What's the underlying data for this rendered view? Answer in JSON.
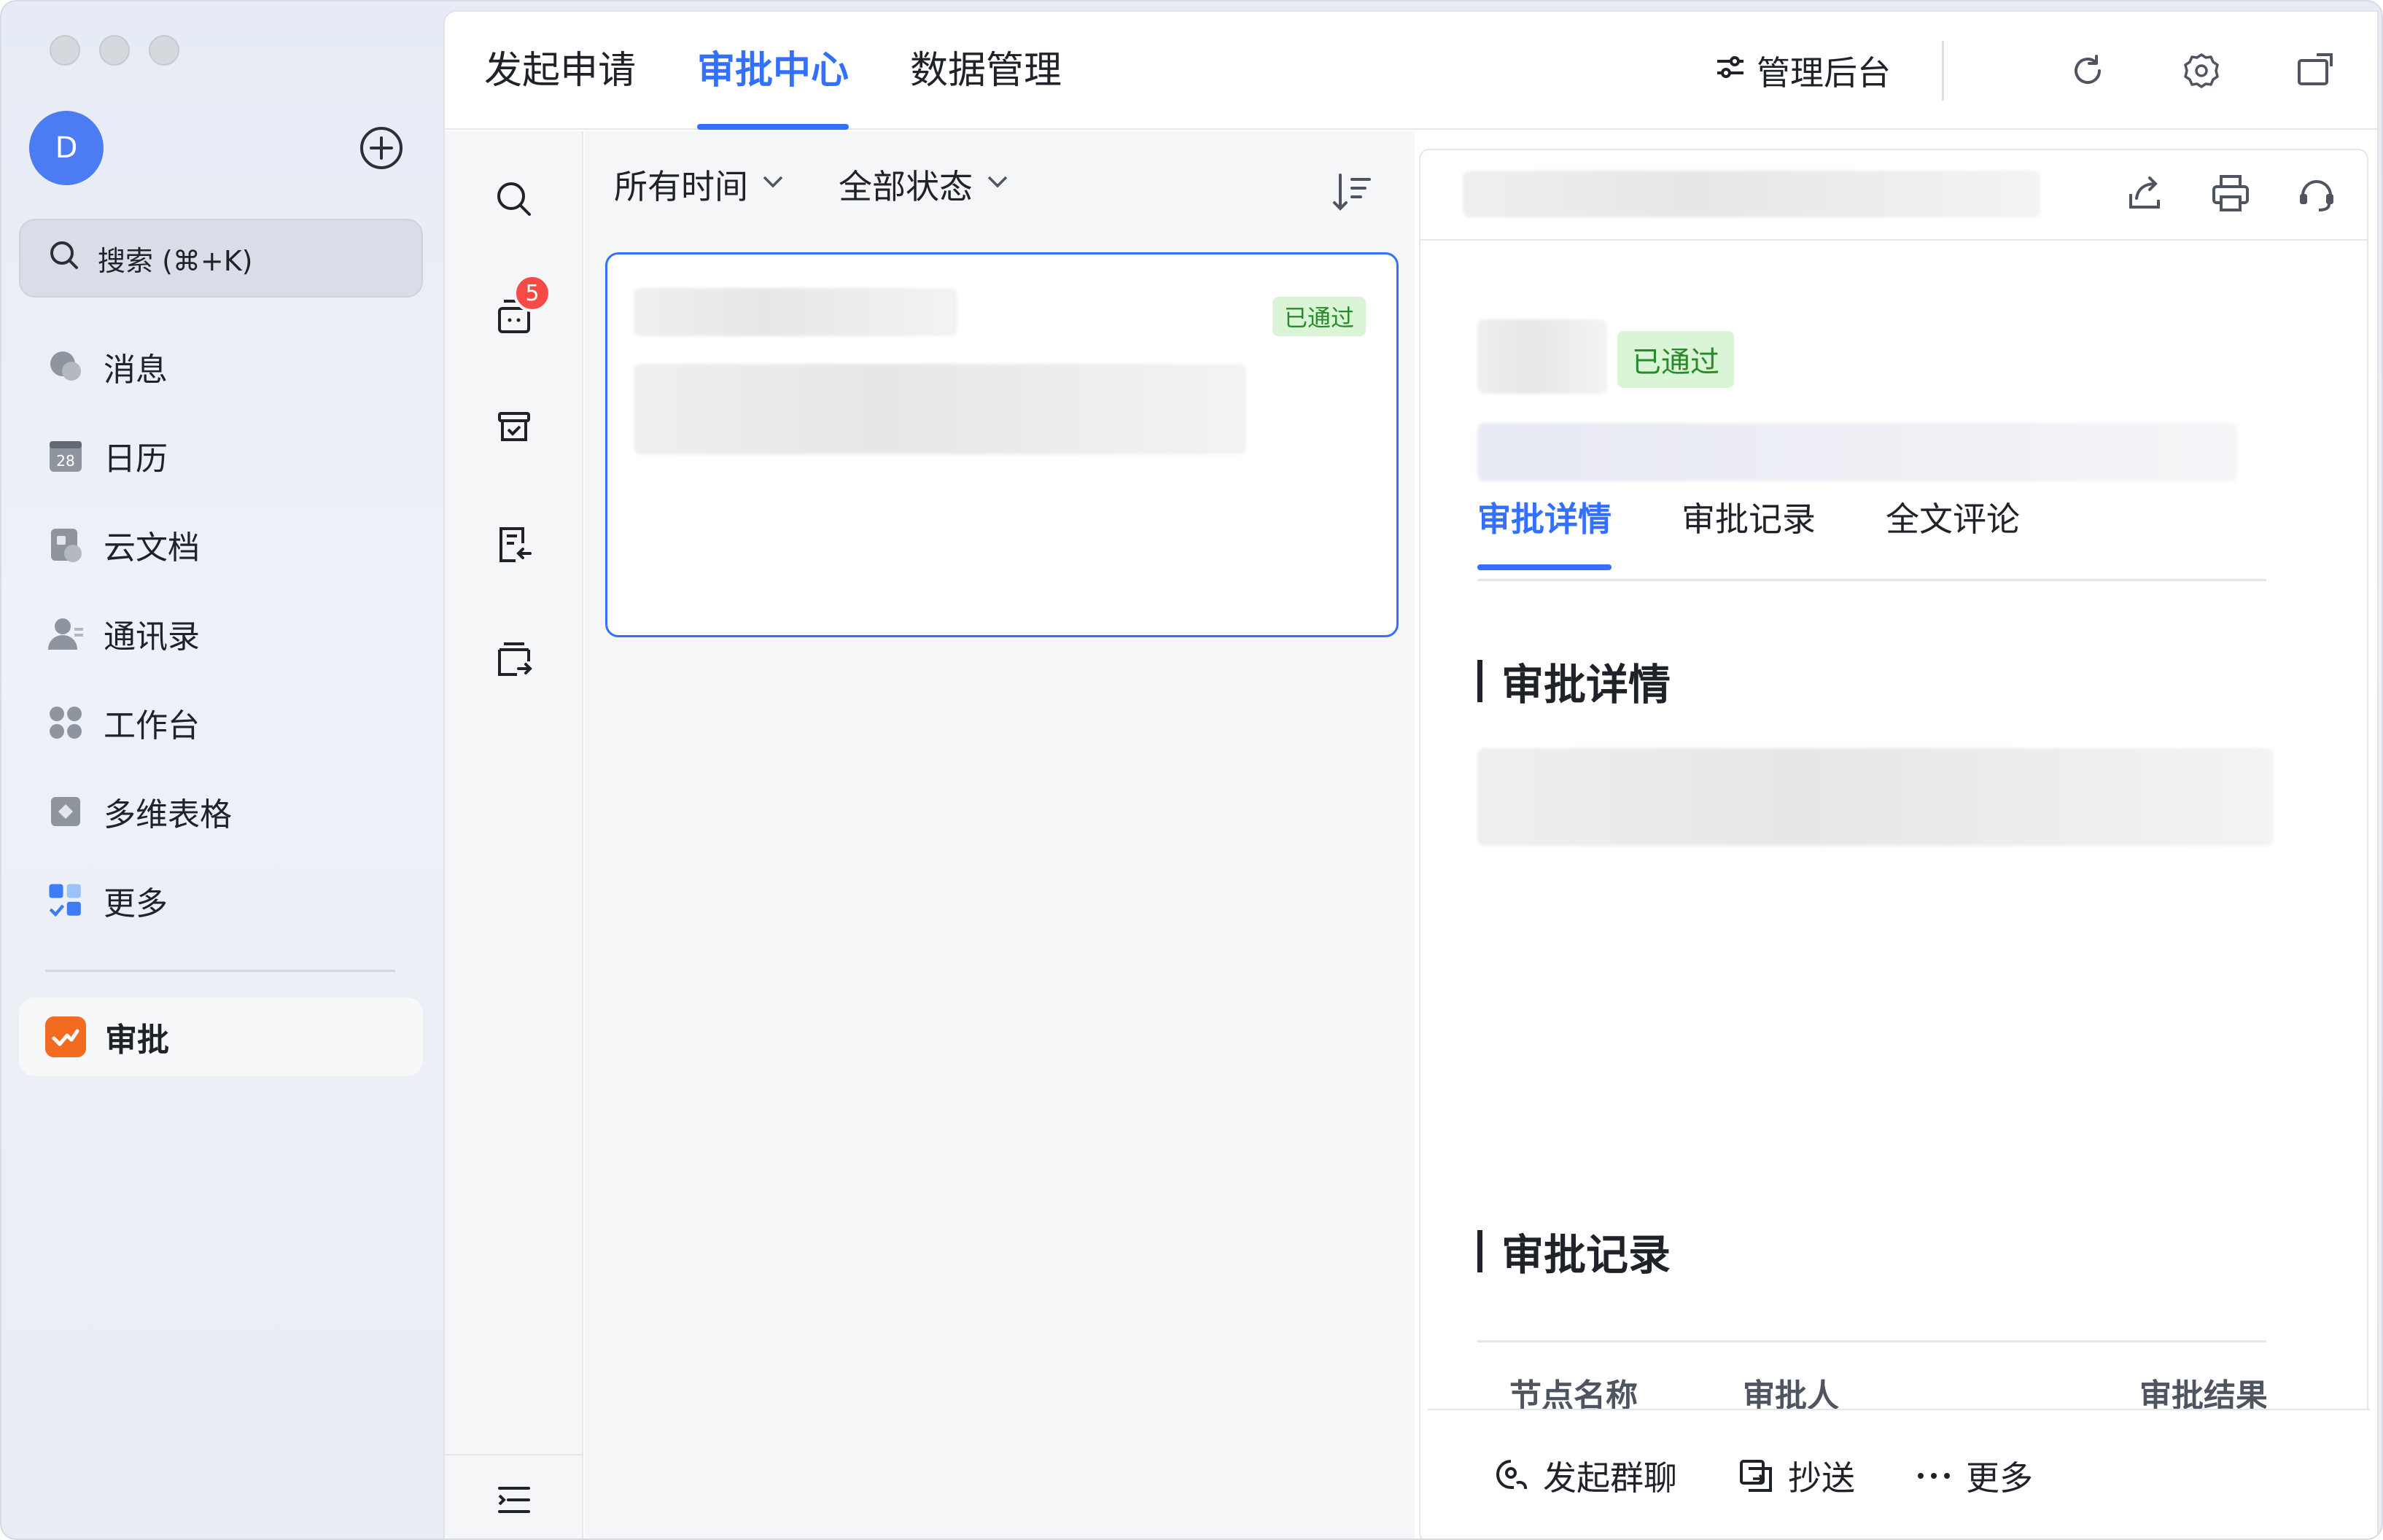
{
  "sidebar": {
    "avatar_initial": "D",
    "search_label": "搜索 (⌘+K)",
    "items": [
      {
        "label": "消息",
        "icon": "chat-bubble-icon"
      },
      {
        "label": "日历",
        "icon": "calendar-icon",
        "icon_text": "28"
      },
      {
        "label": "云文档",
        "icon": "cloud-doc-icon"
      },
      {
        "label": "通讯录",
        "icon": "contacts-icon"
      },
      {
        "label": "工作台",
        "icon": "workspace-grid-icon"
      },
      {
        "label": "多维表格",
        "icon": "base-table-icon"
      },
      {
        "label": "更多",
        "icon": "more-apps-icon"
      }
    ],
    "active_app": {
      "label": "审批",
      "icon": "approval-app-icon",
      "color": "#f26b21"
    }
  },
  "topbar": {
    "tabs": [
      "发起申请",
      "审批中心",
      "数据管理"
    ],
    "active_tab": "审批中心",
    "admin_label": "管理后台"
  },
  "rail": {
    "pending_badge": "5"
  },
  "list": {
    "filter_time": "所有时间",
    "filter_status": "全部状态",
    "card_status": "已通过"
  },
  "detail": {
    "status_tag": "已通过",
    "tabs": [
      "审批详情",
      "审批记录",
      "全文评论"
    ],
    "active_tab": "审批详情",
    "section_detail_title": "审批详情",
    "section_record_title": "审批记录",
    "table_headers": [
      "节点名称",
      "审批人",
      "审批结果"
    ],
    "footer": {
      "group_chat": "发起群聊",
      "cc": "抄送",
      "more": "更多"
    }
  },
  "colors": {
    "accent": "#3370ff",
    "approved_bg": "#d9f5d6",
    "approved_text": "#2a8a2a",
    "badge": "#f54a45"
  }
}
